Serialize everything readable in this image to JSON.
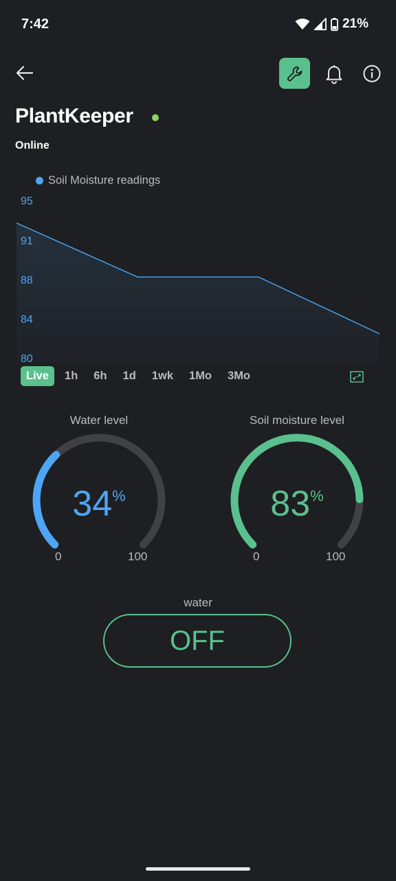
{
  "status_bar": {
    "time": "7:42",
    "battery": "21%",
    "icons": [
      "wifi-icon",
      "signal-icon",
      "battery-icon"
    ]
  },
  "toolbar": {
    "icons": [
      "back-arrow-icon",
      "wrench-icon",
      "bell-icon",
      "info-icon"
    ],
    "accent": "#5ac08d"
  },
  "device": {
    "name": "PlantKeeper",
    "status": "Online",
    "status_color": "#8ed26b"
  },
  "chart_data": {
    "type": "area",
    "legend": "Soil Moisture readings",
    "series": [
      {
        "name": "Soil Moisture readings",
        "color": "#4da6f5",
        "x": [
          0,
          1,
          2,
          3
        ],
        "values": [
          94.0,
          88.4,
          88.4,
          82.5
        ]
      }
    ],
    "y_ticks": [
      "95",
      "91",
      "88",
      "84",
      "80"
    ],
    "ylim": [
      80,
      95
    ],
    "grid": false
  },
  "time_ranges": {
    "items": [
      "Live",
      "1h",
      "6h",
      "1d",
      "1wk",
      "1Mo",
      "3Mo"
    ],
    "selected": "Live"
  },
  "gauges": {
    "water": {
      "title": "Water level",
      "value": "34",
      "unit": "%",
      "fraction": 0.34,
      "min": "0",
      "max": "100",
      "color": "#4da6f5"
    },
    "soil": {
      "title": "Soil moisture level",
      "value": "83",
      "unit": "%",
      "fraction": 0.83,
      "min": "0",
      "max": "100",
      "color": "#5ac08d"
    }
  },
  "water_control": {
    "label": "water",
    "state": "OFF"
  }
}
